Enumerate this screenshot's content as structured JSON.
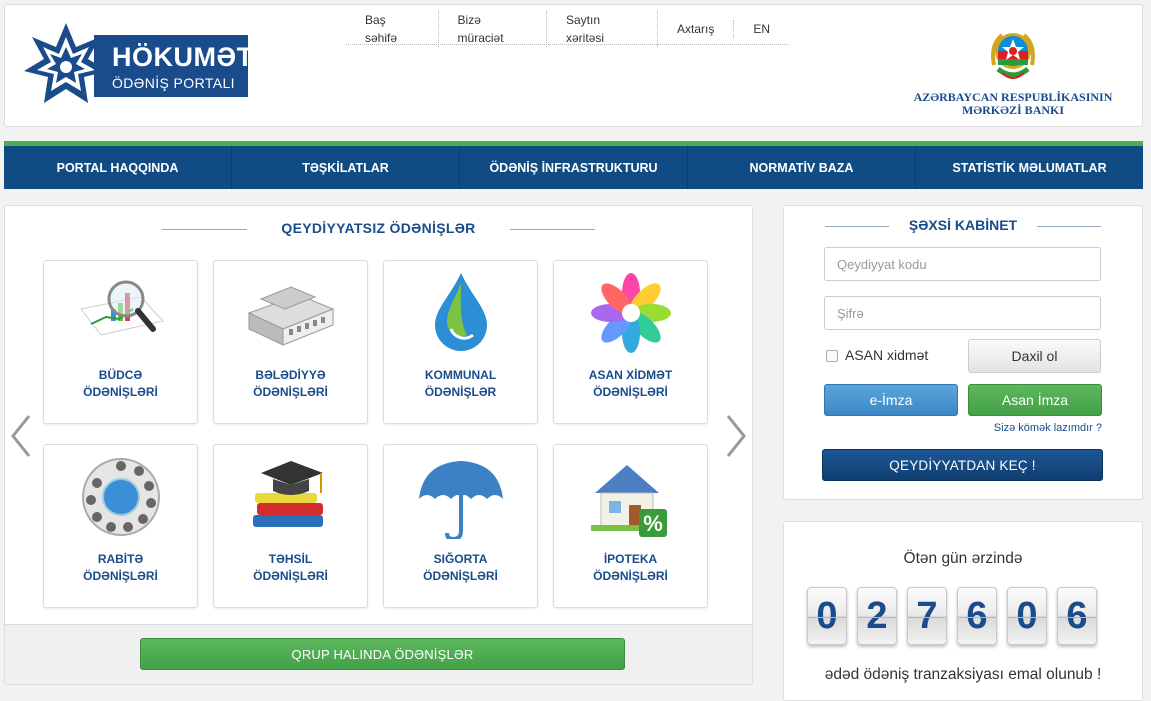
{
  "header": {
    "logo_line1": "HÖKUMƏT",
    "logo_line2": "ÖDƏNİŞ PORTALI",
    "toplinks": [
      "Baş səhifə",
      "Bizə müraciət",
      "Saytın xəritəsi",
      "Axtarış",
      "EN"
    ],
    "bank_line1": "AZƏRBAYCAN RESPUBLİKASININ",
    "bank_line2": "MƏRKƏZİ BANKI"
  },
  "nav": [
    "PORTAL HAQQINDA",
    "TƏŞKİLATLAR",
    "ÖDƏNİŞ İNFRASTRUKTURU",
    "NORMATİV BAZA",
    "STATİSTİK MƏLUMATLAR"
  ],
  "payments": {
    "title": "QEYDİYYATSIZ ÖDƏNİŞLƏR",
    "tiles": [
      {
        "line1": "BÜDCƏ",
        "line2": "ÖDƏNİŞLƏRİ",
        "icon": "budget-chart-icon"
      },
      {
        "line1": "BƏLƏDİYYƏ",
        "line2": "ÖDƏNİŞLƏRİ",
        "icon": "municipality-building-icon"
      },
      {
        "line1": "KOMMUNAL",
        "line2": "ÖDƏNİŞLƏR",
        "icon": "utility-drop-icon"
      },
      {
        "line1": "ASAN XİDMƏT",
        "line2": "ÖDƏNİŞLƏRİ",
        "icon": "asan-flower-icon"
      },
      {
        "line1": "RABİTƏ",
        "line2": "ÖDƏNİŞLƏRİ",
        "icon": "phone-dial-icon"
      },
      {
        "line1": "TƏHSİL",
        "line2": "ÖDƏNİŞLƏRİ",
        "icon": "graduation-books-icon"
      },
      {
        "line1": "SIĞORTA",
        "line2": "ÖDƏNİŞLƏRİ",
        "icon": "umbrella-icon"
      },
      {
        "line1": "İPOTEKA",
        "line2": "ÖDƏNİŞLƏRİ",
        "icon": "house-percent-icon"
      }
    ],
    "group_button": "QRUP HALINDA ÖDƏNİŞLƏR"
  },
  "cabinet": {
    "title": "ŞƏXSİ KABİNET",
    "code_placeholder": "Qeydiyyat kodu",
    "password_placeholder": "Şifrə",
    "asan_checkbox": "ASAN xidmət",
    "login_button": "Daxil ol",
    "eimza_button": "e-İmza",
    "asan_imza_button": "Asan İmza",
    "help_link": "Sizə kömək lazımdır ?",
    "register_button": "QEYDİYYATDAN KEÇ !"
  },
  "counter": {
    "title": "Ötən gün ərzində",
    "digits": [
      "0",
      "2",
      "7",
      "6",
      "0",
      "6"
    ],
    "footer": "ədəd ödəniş tranzaksiyası emal olunub !"
  },
  "colors": {
    "brand_blue": "#114b84",
    "accent_green": "#4cb04f",
    "eimza_blue": "#3d88c4"
  }
}
